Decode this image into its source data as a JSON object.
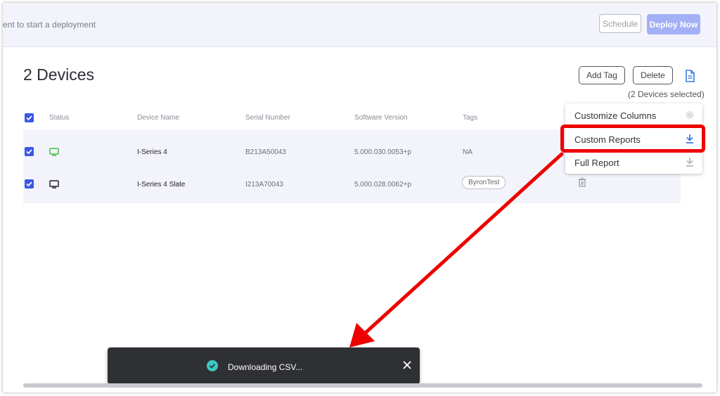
{
  "topbar": {
    "message": "ent to start a deployment",
    "schedule_label": "Schedule",
    "deploy_label": "Deploy Now"
  },
  "page": {
    "title": "2 Devices",
    "add_tag_label": "Add Tag",
    "delete_label": "Delete",
    "export_icon": "document-icon",
    "selected_count": "(2 Devices selected)"
  },
  "table": {
    "headers": {
      "status": "Status",
      "device_name": "Device Name",
      "serial_number": "Serial Number",
      "software_version": "Software Version",
      "tags": "Tags"
    },
    "rows": [
      {
        "status": "online",
        "status_color": "#3fbf3f",
        "name": "I-Series 4",
        "serial": "B213A50043",
        "version": "5.000.030.0053+p",
        "tags": "NA"
      },
      {
        "status": "offline",
        "status_color": "#222222",
        "name": "I-Series 4 Slate",
        "serial": "I213A70043",
        "version": "5.000.028.0062+p",
        "tags": "ByronTest"
      }
    ]
  },
  "menu": {
    "items": [
      {
        "label": "Customize Columns",
        "icon": "gear-icon"
      },
      {
        "label": "Custom Reports",
        "icon": "download-icon"
      },
      {
        "label": "Full Report",
        "icon": "download-icon"
      }
    ]
  },
  "toast": {
    "message": "Downloading CSV...",
    "icon": "check-circle-icon"
  },
  "colors": {
    "accent": "#3b57e4",
    "deploy_button": "#a4b0f5",
    "annotation_red": "#ee0000",
    "toast_bg": "#2f3033",
    "toast_check": "#3ec6c6"
  }
}
